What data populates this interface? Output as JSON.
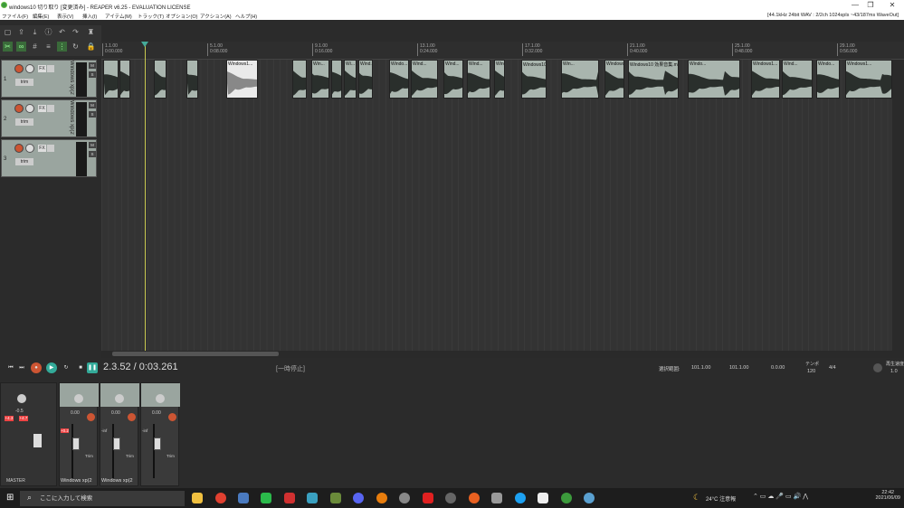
{
  "window": {
    "title": "windows10 切り取り [変更済み] - REAPER v6.25 - EVALUATION LICENSE",
    "minimize": "—",
    "maximize": "❐",
    "close": "✕"
  },
  "menu": {
    "items": [
      "ファイル(F)",
      "編集(E)",
      "表示(V)",
      "挿入(I)",
      "アイテム(M)",
      "トラック(T)",
      "オプション(O)",
      "アクション(A)",
      "ヘルプ(H)"
    ],
    "status": "[44.1kHz 24bit WAV : 2/2ch 1024spls ~43/187ms WaveOut]"
  },
  "tracks": [
    {
      "num": "1",
      "name": "Windows xp(2",
      "fx": "FX",
      "env": "trim",
      "m": "M",
      "s": "S"
    },
    {
      "num": "2",
      "name": "Windows xp(2",
      "fx": "FX",
      "env": "trim",
      "m": "M",
      "s": "S"
    },
    {
      "num": "3",
      "name": "",
      "fx": "FX",
      "env": "trim",
      "m": "M",
      "s": "S"
    }
  ],
  "ruler": {
    "marks": [
      {
        "bar": "1.1.00",
        "time": "0:00.000"
      },
      {
        "bar": "5.1.00",
        "time": "0:08.000"
      },
      {
        "bar": "9.1.00",
        "time": "0:16.000"
      },
      {
        "bar": "13.1.00",
        "time": "0:24.000"
      },
      {
        "bar": "17.1.00",
        "time": "0:32.000"
      },
      {
        "bar": "21.1.00",
        "time": "0:40.000"
      },
      {
        "bar": "25.1.00",
        "time": "0:48.000"
      },
      {
        "bar": "29.1.00",
        "time": "0:56.000"
      }
    ]
  },
  "clips": [
    {
      "name": ""
    },
    {
      "name": ""
    },
    {
      "name": ""
    },
    {
      "name": ""
    },
    {
      "name": "Windows1..."
    },
    {
      "name": ""
    },
    {
      "name": "Win..."
    },
    {
      "name": ""
    },
    {
      "name": "Wi..."
    },
    {
      "name": "Wind..."
    },
    {
      "name": "Windo..."
    },
    {
      "name": "Wind..."
    },
    {
      "name": "Wind..."
    },
    {
      "name": "Wind..."
    },
    {
      "name": "Windo..."
    },
    {
      "name": "Windows10 効..."
    },
    {
      "name": "Win..."
    },
    {
      "name": "Windows1..."
    },
    {
      "name": "Windows10 効果音集.mp3"
    },
    {
      "name": "Windo..."
    },
    {
      "name": "Windows1..."
    },
    {
      "name": "Wind..."
    },
    {
      "name": "Windo..."
    },
    {
      "name": "Windows1..."
    }
  ],
  "transport": {
    "time": "2.3.52 / 0:03.261",
    "status": "[一時停止]",
    "sel_label": "選択範囲:",
    "sel_start": "101.1.00",
    "sel_end": "101.1.00",
    "sel_len": "0.0.00",
    "tempo_label": "テンポ",
    "tempo": "120",
    "timesig": "4/4",
    "rate_label": "再生速度",
    "rate": "1.0"
  },
  "mixer": {
    "master_db": "-0.5",
    "master_left": "+4.3",
    "master_right": "+4.7",
    "master_label": "MASTER",
    "strips": [
      {
        "name": "Windows xp(2",
        "db": "0.00",
        "peak": "+0.2",
        "trim": "Trim"
      },
      {
        "name": "Windows xp(2",
        "db": "0.00",
        "peak": "-inf",
        "trim": "Trim"
      },
      {
        "name": "",
        "db": "0.00",
        "peak": "-inf",
        "trim": "Trim"
      }
    ]
  },
  "taskbar": {
    "search_placeholder": "ここに入力して検索",
    "weather": "24°C 注意報",
    "clock_time": "22:42",
    "clock_date": "2021/06/09"
  }
}
